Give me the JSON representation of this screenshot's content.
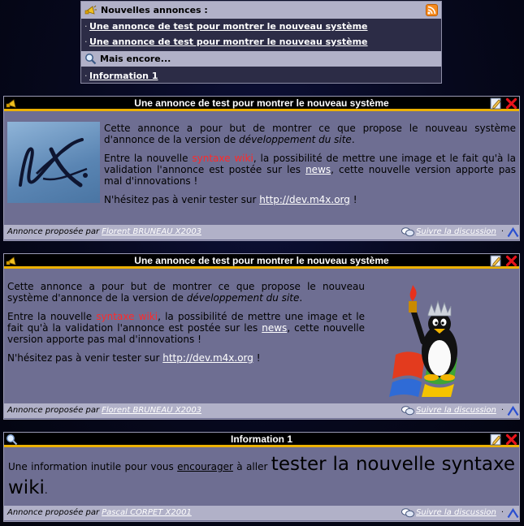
{
  "news": {
    "header": "Nouvelles annonces :",
    "items": [
      "Une annonce de test pour montrer le nouveau système",
      "Une annonce de test pour montrer le nouveau système"
    ],
    "more_label": "Mais encore...",
    "more_items": [
      "Information 1"
    ]
  },
  "articles": [
    {
      "title": "Une annonce de test pour montrer le nouveau système",
      "p1_a": "Cette annonce a pour but de montrer ce que propose le nouveau système d'annonce de la version de ",
      "p1_em": "développement du site",
      "p1_b": ".",
      "p2_a": "Entre la nouvelle ",
      "p2_red": "syntaxe wiki",
      "p2_b": ", la possibilité de mettre une image et le fait qu'à la validation l'annonce est postée sur les ",
      "p2_link": "news",
      "p2_c": ", cette nouvelle version apporte pas mal d'innovations !",
      "p3_a": "N'hésitez pas à venir tester sur ",
      "p3_link": "http://dev.m4x.org",
      "p3_b": " !",
      "footer_prefix": "Annonce proposée par",
      "author": "Florent BRUNEAU X2003",
      "discuss": "Suivre la discussion"
    },
    {
      "title": "Une annonce de test pour montrer le nouveau système",
      "p1_a": "Cette annonce a pour but de montrer ce que propose le nouveau système d'annonce de la version de ",
      "p1_em": "développement du site",
      "p1_b": ".",
      "p2_a": "Entre la nouvelle ",
      "p2_red": "syntaxe wiki",
      "p2_b": ", la possibilité de mettre une image et le fait qu'à la validation l'annonce est postée sur les ",
      "p2_link": "news",
      "p2_c": ", cette nouvelle version apporte pas mal d'innovations !",
      "p3_a": "N'hésitez pas à venir tester sur ",
      "p3_link": "http://dev.m4x.org",
      "p3_b": " !",
      "footer_prefix": "Annonce proposée par",
      "author": "Florent BRUNEAU X2003",
      "discuss": "Suivre la discussion"
    }
  ],
  "info": {
    "title": "Information 1",
    "t1": "Une information inutile pour vous ",
    "t_under": "encourager",
    "t2": " à aller ",
    "t_big": "tester la nouvelle syntaxe wiki",
    "t3": ".",
    "footer_prefix": "Annonce proposée par",
    "author": "Pascal CORPET X2001",
    "discuss": "Suivre la discussion"
  },
  "icons": {
    "announce": "megaphone-icon",
    "rss": "rss-icon",
    "search": "magnifier-icon",
    "edit": "edit-icon",
    "delete": "delete-icon",
    "discussion": "speech-bubbles-icon",
    "up": "up-arrow-icon"
  },
  "colors": {
    "panel_bg": "#6e6e92",
    "band": "#b1b1c8",
    "header_bg": "#000000",
    "header_accent": "#ecb100",
    "wiki_red": "#ff2a2a"
  }
}
